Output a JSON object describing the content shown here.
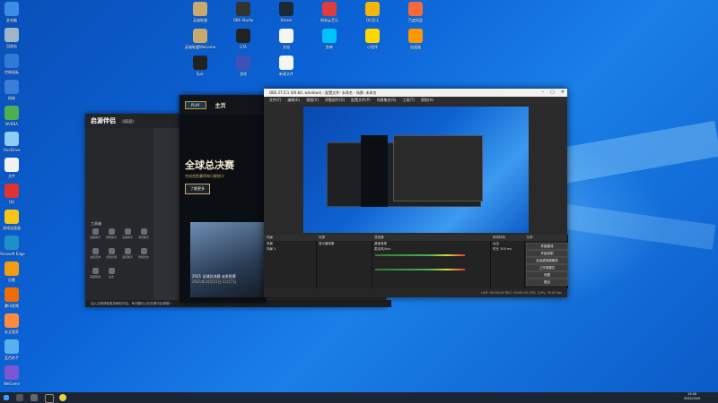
{
  "desktop": {
    "icons_left": [
      {
        "label": "此电脑",
        "color": "#3a8ee6"
      },
      {
        "label": "回收站",
        "color": "#9fb6c8"
      },
      {
        "label": "控制面板",
        "color": "#2e7bd6"
      },
      {
        "label": "网络",
        "color": "#3b7dd8"
      },
      {
        "label": "NVIDIA",
        "color": "#4caf50"
      },
      {
        "label": "OneDrive",
        "color": "#8ecdf5"
      },
      {
        "label": "文件",
        "color": "#f2f2f2"
      },
      {
        "label": "QQ",
        "color": "#d33"
      },
      {
        "label": "游戏加速器",
        "color": "#f5c518"
      },
      {
        "label": "Microsoft Edge",
        "color": "#1e90c8"
      },
      {
        "label": "迅雷",
        "color": "#f39c12"
      },
      {
        "label": "腾讯视频",
        "color": "#ef6c00"
      },
      {
        "label": "安全管家",
        "color": "#ff8a3c"
      },
      {
        "label": "蓝色助手",
        "color": "#5ab0ef"
      },
      {
        "label": "WeGame",
        "color": "#7b57d1"
      }
    ],
    "icons_top": [
      {
        "label": "英雄联盟",
        "color": "#c8aa6e"
      },
      {
        "label": "OBS Studio",
        "color": "#333"
      },
      {
        "label": "Steam",
        "color": "#1b2838"
      },
      {
        "label": "网易云音乐",
        "color": "#e03c3c"
      },
      {
        "label": "QQ音乐",
        "color": "#f2b705"
      },
      {
        "label": "百度网盘",
        "color": "#f46a3a"
      },
      {
        "label": "英雄联盟WeGame",
        "color": "#c8aa6e"
      },
      {
        "label": "GTA",
        "color": "#222"
      },
      {
        "label": "文档",
        "color": "#f5f5f5"
      },
      {
        "label": "剪映",
        "color": "#00c2ff"
      },
      {
        "label": "小程序",
        "color": "#ffd600"
      },
      {
        "label": "加速器",
        "color": "#ff9800"
      },
      {
        "label": "Epic",
        "color": "#222"
      },
      {
        "label": "游戏",
        "color": "#3f51b5"
      },
      {
        "label": "新建文件",
        "color": "#f5f5f5"
      }
    ]
  },
  "app1": {
    "logo": "启源伴侣",
    "version": "v1.0",
    "section_label": "工具箱",
    "status_text": "加入社群获取更多精彩内容，有问题可以在社群中反馈哦~",
    "tools": [
      "截图助手",
      "录制助手",
      "直播助手",
      "游戏助手",
      "战绩查询",
      "皮肤管理",
      "语音助手",
      "网络优化",
      "英雄联盟",
      "设置"
    ]
  },
  "lol": {
    "play_label": "PLAY",
    "home_label": "主页",
    "headline": "全球总决赛",
    "subline": "完成首胜赢得每日解锁卡",
    "button": "了解更多",
    "card_title": "2021 全球总决赛 派发投票",
    "card_date": "2021年10月15日-11月7日"
  },
  "obs": {
    "title": "OBS 27.0.1 (64-bit, windows) - 配置文件: 未命名 - 场景: 未命名",
    "menu": [
      "文件(F)",
      "编辑(E)",
      "视图(V)",
      "停靠部件(D)",
      "配置文件(P)",
      "场景集合(S)",
      "工具(T)",
      "帮助(H)"
    ],
    "source_label": "未选择源",
    "panels": [
      {
        "title": "场景",
        "rows": [
          "场景",
          "场景 2"
        ]
      },
      {
        "title": "来源",
        "rows": [
          "显示器采集"
        ]
      },
      {
        "title": "混音器",
        "rows": [
          "桌面音频",
          "麦克风/Aux"
        ]
      },
      {
        "title": "转场特效",
        "rows": [
          "淡出",
          "时长 300 ms"
        ]
      },
      {
        "title": "控件",
        "rows": []
      }
    ],
    "controls": [
      "开始推流",
      "开始录制",
      "启动虚拟摄像机",
      "工作室模式",
      "设置",
      "退出"
    ],
    "footer": "LIVE: 00:00:00  REC: 00:00:00  CPU: 3.0%, 30.00 fps"
  },
  "taskbar": {
    "time": "13:40",
    "date": "2021/10/4"
  }
}
